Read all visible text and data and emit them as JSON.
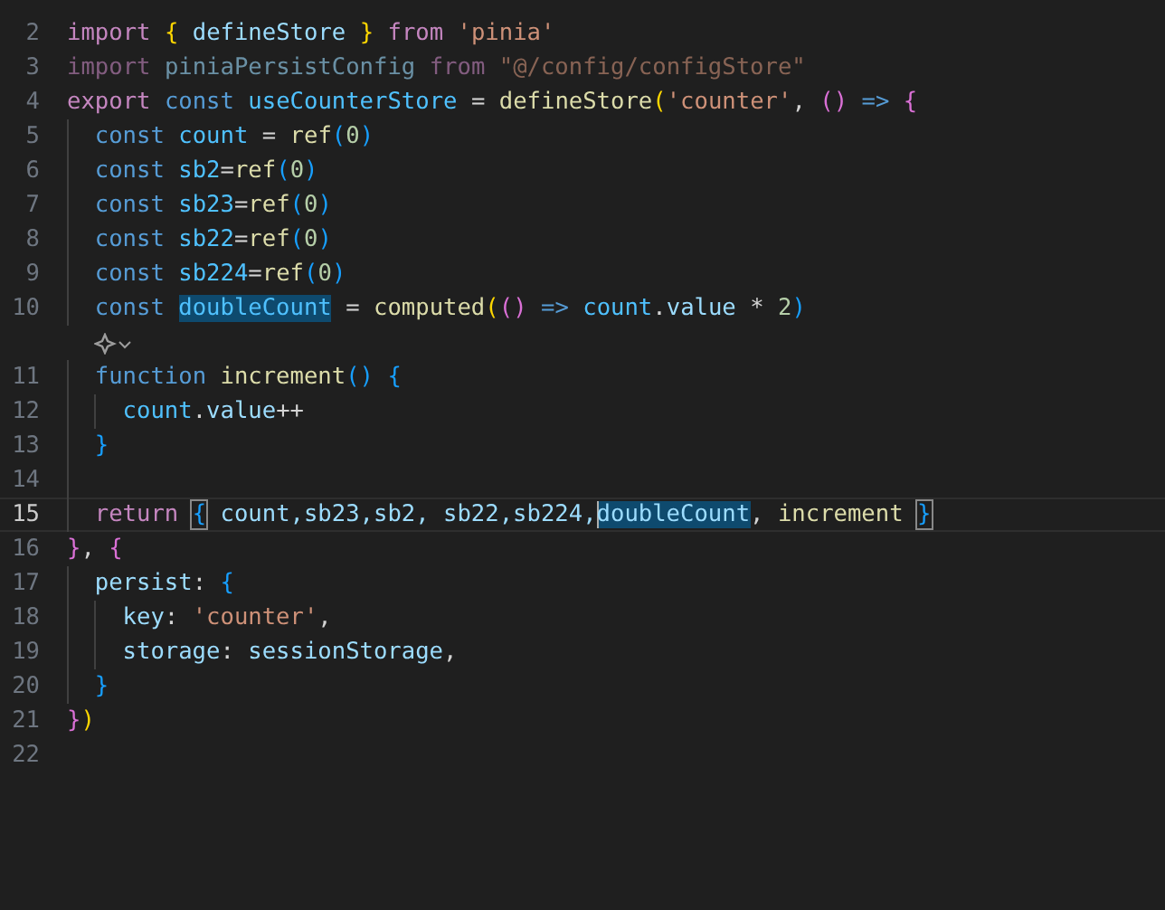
{
  "editor": {
    "lines": [
      {
        "kind": "code",
        "number": "2",
        "active": false,
        "faded": false,
        "tokens": [
          {
            "text": "import",
            "kind": "kw"
          },
          {
            "text": " {",
            "kind": "b1"
          },
          {
            "text": " defineStore",
            "kind": "var"
          },
          {
            "text": " }",
            "kind": "b1"
          },
          {
            "text": " from",
            "kind": "kw"
          },
          {
            "text": " 'pinia'",
            "kind": "str"
          }
        ]
      },
      {
        "kind": "code",
        "number": "3",
        "active": false,
        "faded": true,
        "tokens": [
          {
            "text": "import",
            "kind": "kw"
          },
          {
            "text": " piniaPersistConfig",
            "kind": "var"
          },
          {
            "text": " from",
            "kind": "kw"
          },
          {
            "text": " \"@/config/configStore\"",
            "kind": "str"
          }
        ]
      },
      {
        "kind": "code",
        "number": "4",
        "active": false,
        "faded": false,
        "tokens": [
          {
            "text": "export",
            "kind": "kw"
          },
          {
            "text": " const",
            "kind": "storage"
          },
          {
            "text": " useCounterStore",
            "kind": "const"
          },
          {
            "text": " = ",
            "kind": "punct"
          },
          {
            "text": "defineStore",
            "kind": "fn"
          },
          {
            "text": "(",
            "kind": "b1"
          },
          {
            "text": "'counter'",
            "kind": "str"
          },
          {
            "text": ", ",
            "kind": "punct"
          },
          {
            "text": "()",
            "kind": "b2"
          },
          {
            "text": " =>",
            "kind": "storage"
          },
          {
            "text": " {",
            "kind": "b2"
          }
        ]
      },
      {
        "kind": "code",
        "number": "5",
        "active": false,
        "faded": false,
        "guides": [
          true
        ],
        "tokens": [
          {
            "text": "const",
            "kind": "storage"
          },
          {
            "text": " count",
            "kind": "const"
          },
          {
            "text": " = ",
            "kind": "punct"
          },
          {
            "text": "ref",
            "kind": "fn"
          },
          {
            "text": "(",
            "kind": "b3"
          },
          {
            "text": "0",
            "kind": "num"
          },
          {
            "text": ")",
            "kind": "b3"
          }
        ]
      },
      {
        "kind": "code",
        "number": "6",
        "active": false,
        "faded": false,
        "guides": [
          true
        ],
        "tokens": [
          {
            "text": "const",
            "kind": "storage"
          },
          {
            "text": " sb2",
            "kind": "const"
          },
          {
            "text": "=",
            "kind": "punct"
          },
          {
            "text": "ref",
            "kind": "fn"
          },
          {
            "text": "(",
            "kind": "b3"
          },
          {
            "text": "0",
            "kind": "num"
          },
          {
            "text": ")",
            "kind": "b3"
          }
        ]
      },
      {
        "kind": "code",
        "number": "7",
        "active": false,
        "faded": false,
        "guides": [
          true
        ],
        "tokens": [
          {
            "text": "const",
            "kind": "storage"
          },
          {
            "text": " sb23",
            "kind": "const"
          },
          {
            "text": "=",
            "kind": "punct"
          },
          {
            "text": "ref",
            "kind": "fn"
          },
          {
            "text": "(",
            "kind": "b3"
          },
          {
            "text": "0",
            "kind": "num"
          },
          {
            "text": ")",
            "kind": "b3"
          }
        ]
      },
      {
        "kind": "code",
        "number": "8",
        "active": false,
        "faded": false,
        "guides": [
          true
        ],
        "tokens": [
          {
            "text": "const",
            "kind": "storage"
          },
          {
            "text": " sb22",
            "kind": "const"
          },
          {
            "text": "=",
            "kind": "punct"
          },
          {
            "text": "ref",
            "kind": "fn"
          },
          {
            "text": "(",
            "kind": "b3"
          },
          {
            "text": "0",
            "kind": "num"
          },
          {
            "text": ")",
            "kind": "b3"
          }
        ]
      },
      {
        "kind": "code",
        "number": "9",
        "active": false,
        "faded": false,
        "guides": [
          true
        ],
        "tokens": [
          {
            "text": "const",
            "kind": "storage"
          },
          {
            "text": " sb224",
            "kind": "const"
          },
          {
            "text": "=",
            "kind": "punct"
          },
          {
            "text": "ref",
            "kind": "fn"
          },
          {
            "text": "(",
            "kind": "b3"
          },
          {
            "text": "0",
            "kind": "num"
          },
          {
            "text": ")",
            "kind": "b3"
          }
        ]
      },
      {
        "kind": "code",
        "number": "10",
        "active": false,
        "faded": false,
        "guides": [
          true
        ],
        "tokens": [
          {
            "text": "const ",
            "kind": "storage"
          },
          {
            "text": "doubleCount",
            "kind": "const",
            "highlighted": true
          },
          {
            "text": " = ",
            "kind": "punct"
          },
          {
            "text": "computed",
            "kind": "fn"
          },
          {
            "text": "(",
            "kind": "b1"
          },
          {
            "text": "()",
            "kind": "b2"
          },
          {
            "text": " =>",
            "kind": "storage"
          },
          {
            "text": " count",
            "kind": "const"
          },
          {
            "text": ".",
            "kind": "punct"
          },
          {
            "text": "value",
            "kind": "var"
          },
          {
            "text": " * ",
            "kind": "punct"
          },
          {
            "text": "2",
            "kind": "num"
          },
          {
            "text": ")",
            "kind": "b3"
          }
        ]
      },
      {
        "kind": "hint"
      },
      {
        "kind": "code",
        "number": "11",
        "active": false,
        "faded": false,
        "guides": [
          true
        ],
        "tokens": [
          {
            "text": "function",
            "kind": "storage"
          },
          {
            "text": " increment",
            "kind": "fn"
          },
          {
            "text": "()",
            "kind": "b3"
          },
          {
            "text": " {",
            "kind": "b3"
          }
        ]
      },
      {
        "kind": "code",
        "number": "12",
        "active": false,
        "faded": false,
        "guides": [
          true,
          true
        ],
        "tokens": [
          {
            "text": "count",
            "kind": "const"
          },
          {
            "text": ".",
            "kind": "punct"
          },
          {
            "text": "value",
            "kind": "var"
          },
          {
            "text": "++",
            "kind": "punct"
          }
        ]
      },
      {
        "kind": "code",
        "number": "13",
        "active": false,
        "faded": false,
        "guides": [
          true
        ],
        "tokens": [
          {
            "text": "}",
            "kind": "b3"
          }
        ]
      },
      {
        "kind": "code",
        "number": "14",
        "active": false,
        "faded": false,
        "guides": [
          true
        ]
      },
      {
        "kind": "code",
        "number": "15",
        "active": true,
        "faded": false,
        "guides": [
          true
        ],
        "tokens": [
          {
            "text": "return ",
            "kind": "kw"
          },
          {
            "text": "{",
            "kind": "b3",
            "matched": true
          },
          {
            "text": " count,sb23,sb2, sb22,sb224,",
            "kind": "var"
          },
          {
            "text": "doubleCount",
            "kind": "var",
            "highlighted": true,
            "cursor": true
          },
          {
            "text": ", ",
            "kind": "punct"
          },
          {
            "text": "increment ",
            "kind": "fn"
          },
          {
            "text": "}",
            "kind": "b3",
            "matched": true
          }
        ]
      },
      {
        "kind": "code",
        "number": "16",
        "active": false,
        "faded": false,
        "tokens": [
          {
            "text": "}",
            "kind": "b2"
          },
          {
            "text": ", ",
            "kind": "punct"
          },
          {
            "text": "{",
            "kind": "b2"
          }
        ]
      },
      {
        "kind": "code",
        "number": "17",
        "active": false,
        "faded": false,
        "guides": [
          true
        ],
        "tokens": [
          {
            "text": "persist",
            "kind": "var"
          },
          {
            "text": ": ",
            "kind": "punct"
          },
          {
            "text": "{",
            "kind": "b3"
          }
        ]
      },
      {
        "kind": "code",
        "number": "18",
        "active": false,
        "faded": false,
        "guides": [
          true,
          true
        ],
        "tokens": [
          {
            "text": "key",
            "kind": "var"
          },
          {
            "text": ": ",
            "kind": "punct"
          },
          {
            "text": "'counter'",
            "kind": "str"
          },
          {
            "text": ",",
            "kind": "punct"
          }
        ]
      },
      {
        "kind": "code",
        "number": "19",
        "active": false,
        "faded": false,
        "guides": [
          true,
          true
        ],
        "tokens": [
          {
            "text": "storage",
            "kind": "var"
          },
          {
            "text": ": ",
            "kind": "punct"
          },
          {
            "text": "sessionStorage",
            "kind": "var"
          },
          {
            "text": ",",
            "kind": "punct"
          }
        ]
      },
      {
        "kind": "code",
        "number": "20",
        "active": false,
        "faded": false,
        "guides": [
          true
        ],
        "tokens": [
          {
            "text": "}",
            "kind": "b3"
          }
        ]
      },
      {
        "kind": "code",
        "number": "21",
        "active": false,
        "faded": false,
        "tokens": [
          {
            "text": "}",
            "kind": "b2"
          },
          {
            "text": ")",
            "kind": "b1"
          }
        ]
      },
      {
        "kind": "code",
        "number": "22",
        "active": false
      }
    ]
  }
}
